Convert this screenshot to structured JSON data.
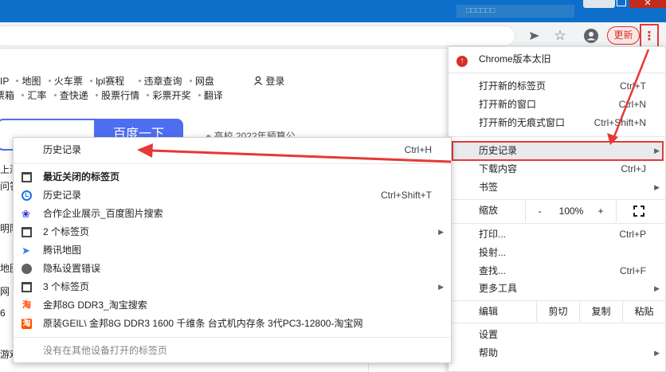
{
  "window": {
    "blurred_title": "□□□□□□",
    "close_glyph": "✕",
    "colors": {
      "titlebar": "#0e6fcb",
      "close": "#c42b1c",
      "annotation": "#e53935"
    }
  },
  "toolbar": {
    "send_icon": "send-icon",
    "bookmark_glyph": "☆",
    "profile_icon": "profile-icon",
    "update_label": "更新",
    "menu_glyph": "⋮"
  },
  "page": {
    "nav_row1": [
      "IP",
      "地图",
      "火车票",
      "lpl赛程",
      "违章查询",
      "网盘"
    ],
    "nav_row2": [
      "票箱",
      "汇率",
      "查快递",
      "股票行情",
      "彩票开奖",
      "翻译"
    ],
    "login": "登录",
    "search_button": "百度一下",
    "news": "高校 2022年预算公",
    "left_fragments": [
      "上海",
      "问答",
      "明阴",
      "地图",
      "网",
      "6",
      "游戏"
    ]
  },
  "menu": {
    "update_item": "Chrome版本太旧",
    "update_glyph": "↑",
    "items": [
      {
        "label": "打开新的标签页",
        "shortcut": "Ctrl+T"
      },
      {
        "label": "打开新的窗口",
        "shortcut": "Ctrl+N"
      },
      {
        "label": "打开新的无痕式窗口",
        "shortcut": "Ctrl+Shift+N"
      },
      {
        "label": "历史记录",
        "shortcut": ""
      },
      {
        "label": "下载内容",
        "shortcut": "Ctrl+J"
      },
      {
        "label": "书签",
        "shortcut": ""
      },
      {
        "label": "打印...",
        "shortcut": "Ctrl+P"
      },
      {
        "label": "投射...",
        "shortcut": ""
      },
      {
        "label": "查找...",
        "shortcut": "Ctrl+F"
      },
      {
        "label": "更多工具",
        "shortcut": ""
      },
      {
        "label": "设置",
        "shortcut": ""
      },
      {
        "label": "帮助",
        "shortcut": ""
      }
    ],
    "zoom": {
      "label": "缩放",
      "minus": "-",
      "value": "100%",
      "plus": "+"
    },
    "edit": {
      "label": "编辑",
      "cut": "剪切",
      "copy": "复制",
      "paste": "粘贴"
    },
    "submenu_arrow": "▶"
  },
  "history_submenu": {
    "header": {
      "label": "历史记录",
      "shortcut": "Ctrl+H"
    },
    "recently_closed": "最近关闭的标签页",
    "items": [
      {
        "label": "历史记录",
        "shortcut": "Ctrl+Shift+T",
        "icon": "history-clock-icon"
      },
      {
        "label": "合作企业展示_百度图片搜索",
        "shortcut": "",
        "icon": "baidu-paw-icon"
      },
      {
        "label": "2 个标签页",
        "shortcut": "",
        "icon": "window-icon"
      },
      {
        "label": "腾讯地图",
        "shortcut": "",
        "icon": "tencent-map-icon"
      },
      {
        "label": "隐私设置错误",
        "shortcut": "",
        "icon": "globe-icon"
      },
      {
        "label": "3 个标签页",
        "shortcut": "",
        "icon": "window-icon"
      },
      {
        "label": "金邦8G DDR3_淘宝搜索",
        "shortcut": "",
        "icon": "taobao-icon"
      },
      {
        "label": "原装GEIL\\ 金邦8G DDR3 1600 千维条 台式机内存条 3代PC3-12800-淘宝网",
        "shortcut": "",
        "icon": "taobao-icon"
      }
    ],
    "other_devices": "没有在其他设备打开的标签页",
    "glyphs": {
      "paw": "❀",
      "map": "➤",
      "globe": "●",
      "tao": "淘"
    }
  }
}
